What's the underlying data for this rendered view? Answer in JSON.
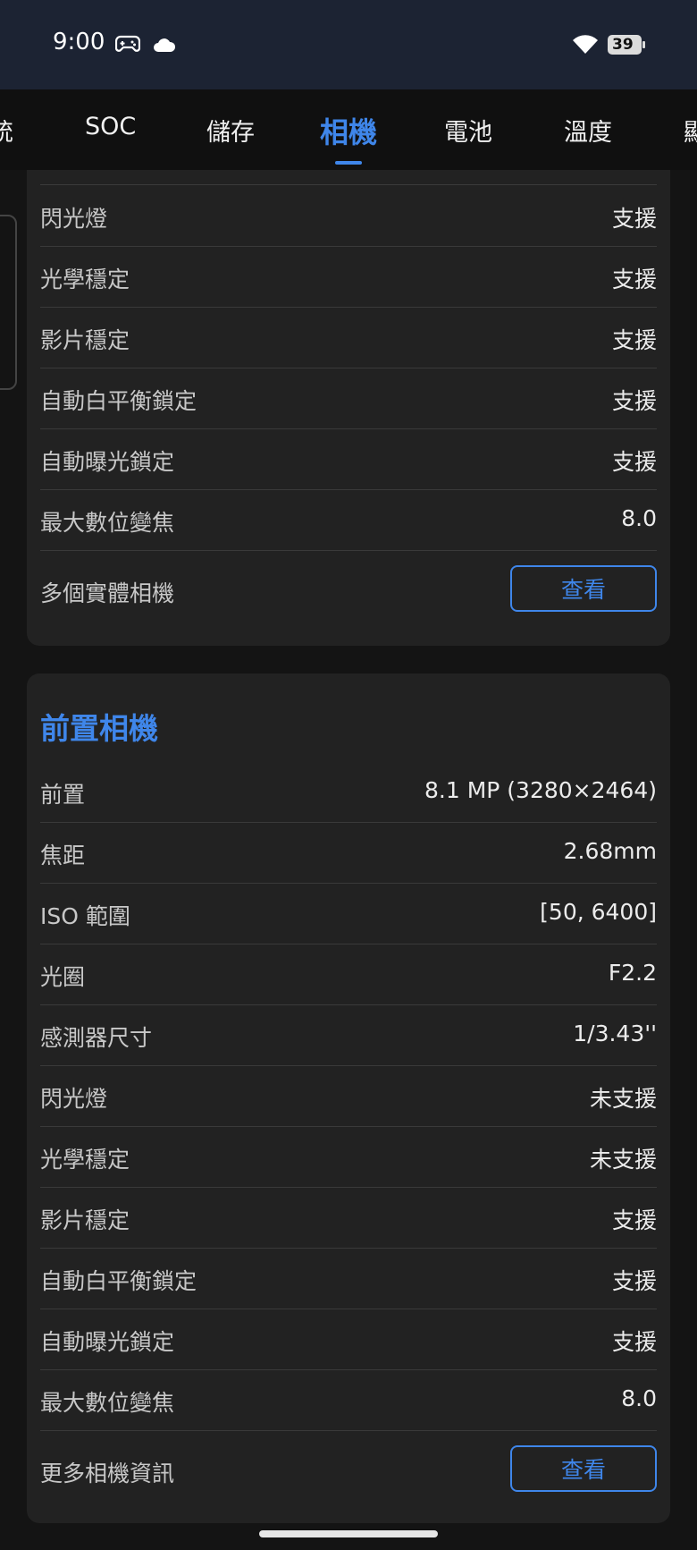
{
  "status_bar": {
    "time": "9:00",
    "icons": [
      "gamepad-icon",
      "cloud-icon",
      "wifi-icon",
      "battery-icon"
    ],
    "battery_level": "39"
  },
  "tabs": {
    "items": [
      {
        "label": "統"
      },
      {
        "label": "SOC"
      },
      {
        "label": "儲存"
      },
      {
        "label": "相機"
      },
      {
        "label": "電池"
      },
      {
        "label": "溫度"
      },
      {
        "label": "顯"
      }
    ],
    "active_index": 3
  },
  "rear_camera": {
    "rows": [
      {
        "label": "閃光燈",
        "value": "支援"
      },
      {
        "label": "光學穩定",
        "value": "支援"
      },
      {
        "label": "影片穩定",
        "value": "支援"
      },
      {
        "label": "自動白平衡鎖定",
        "value": "支援"
      },
      {
        "label": "自動曝光鎖定",
        "value": "支援"
      },
      {
        "label": "最大數位變焦",
        "value": "8.0"
      }
    ],
    "action_row": {
      "label": "多個實體相機",
      "button": "查看"
    }
  },
  "front_camera": {
    "title": "前置相機",
    "rows": [
      {
        "label": "前置",
        "value": "8.1 MP (3280×2464)"
      },
      {
        "label": "焦距",
        "value": "2.68mm"
      },
      {
        "label": "ISO 範圍",
        "value": "[50, 6400]"
      },
      {
        "label": "光圈",
        "value": "F2.2"
      },
      {
        "label": "感測器尺寸",
        "value": "1/3.43''"
      },
      {
        "label": "閃光燈",
        "value": "未支援"
      },
      {
        "label": "光學穩定",
        "value": "未支援"
      },
      {
        "label": "影片穩定",
        "value": "支援"
      },
      {
        "label": "自動白平衡鎖定",
        "value": "支援"
      },
      {
        "label": "自動曝光鎖定",
        "value": "支援"
      },
      {
        "label": "最大數位變焦",
        "value": "8.0"
      }
    ],
    "action_row": {
      "label": "更多相機資訊",
      "button": "查看"
    }
  },
  "colors": {
    "accent": "#3f86ea",
    "card": "#222222",
    "background": "#141414",
    "status_bar": "#1c2333"
  }
}
